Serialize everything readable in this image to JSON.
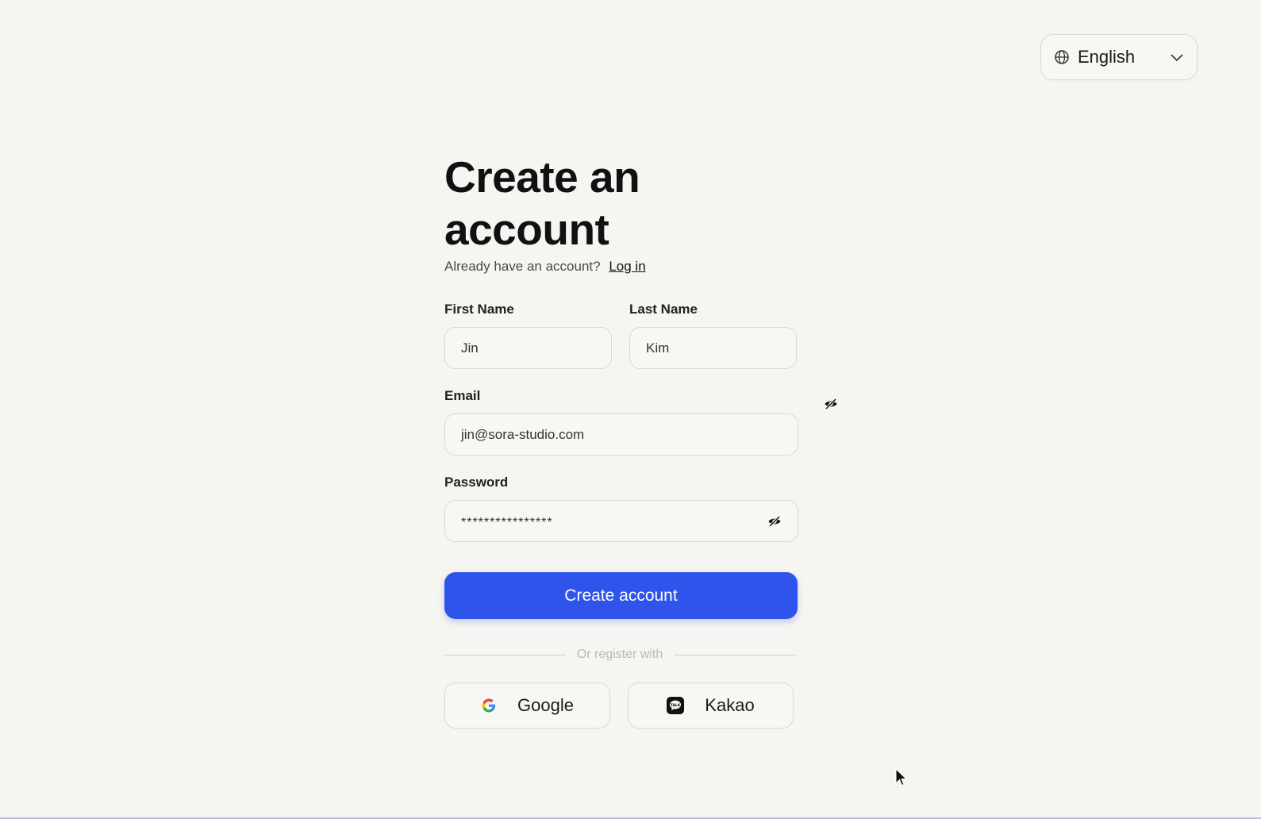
{
  "language_selector": {
    "label": "English",
    "globe_icon": "globe-icon",
    "chevron_icon": "chevron-down-icon"
  },
  "form": {
    "title": "Create an account",
    "subtitle_text": "Already have an account?",
    "login_link": "Log in",
    "first_name": {
      "label": "First Name",
      "value": "Jin"
    },
    "last_name": {
      "label": "Last Name",
      "value": "Kim"
    },
    "email": {
      "label": "Email",
      "value": "jin@sora-studio.com"
    },
    "password": {
      "label": "Password",
      "value": "****************",
      "toggle_icon": "eye-off-icon"
    },
    "submit_label": "Create account",
    "divider_text": "Or register with",
    "social": [
      {
        "label": "Google",
        "icon": "google-icon"
      },
      {
        "label": "Kakao",
        "icon": "kakao-icon"
      }
    ]
  },
  "colors": {
    "background": "#f5f5f1",
    "primary": "#2f54eb",
    "border": "#d8d8d4"
  }
}
